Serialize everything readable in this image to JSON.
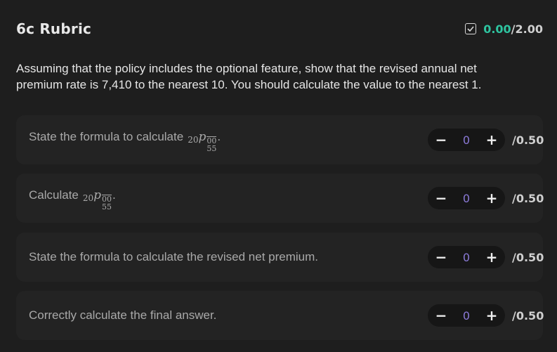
{
  "header": {
    "title": "6c Rubric",
    "score_current": "0.00",
    "score_separator": "/",
    "score_max": "2.00",
    "score_icon": "checkbox-checked-icon",
    "score_color": "#2ec4a0"
  },
  "prompt": "Assuming that the policy includes the optional feature, show that the revised annual net premium rate is 7,410 to the nearest 10. You should calculate the value to the nearest 1.",
  "criteria": [
    {
      "label": "State the formula to calculate",
      "math": {
        "pre_sub": "20",
        "symbol": "p",
        "sup": "00",
        "sub": "55",
        "trail": "."
      },
      "minus": "−",
      "value": "0",
      "plus": "+",
      "max": "/0.50"
    },
    {
      "label": "Calculate",
      "math": {
        "pre_sub": "20",
        "symbol": "p",
        "sup": "00",
        "sub": "55",
        "trail": "."
      },
      "minus": "−",
      "value": "0",
      "plus": "+",
      "max": "/0.50"
    },
    {
      "label": "State the formula to calculate the revised net premium.",
      "minus": "−",
      "value": "0",
      "plus": "+",
      "max": "/0.50"
    },
    {
      "label": "Correctly calculate the final answer.",
      "minus": "−",
      "value": "0",
      "plus": "+",
      "max": "/0.50"
    }
  ],
  "colors": {
    "background": "#1e1e1e",
    "row_background": "#232323",
    "stepper_background": "#161616",
    "value_color": "#8a79d6"
  }
}
